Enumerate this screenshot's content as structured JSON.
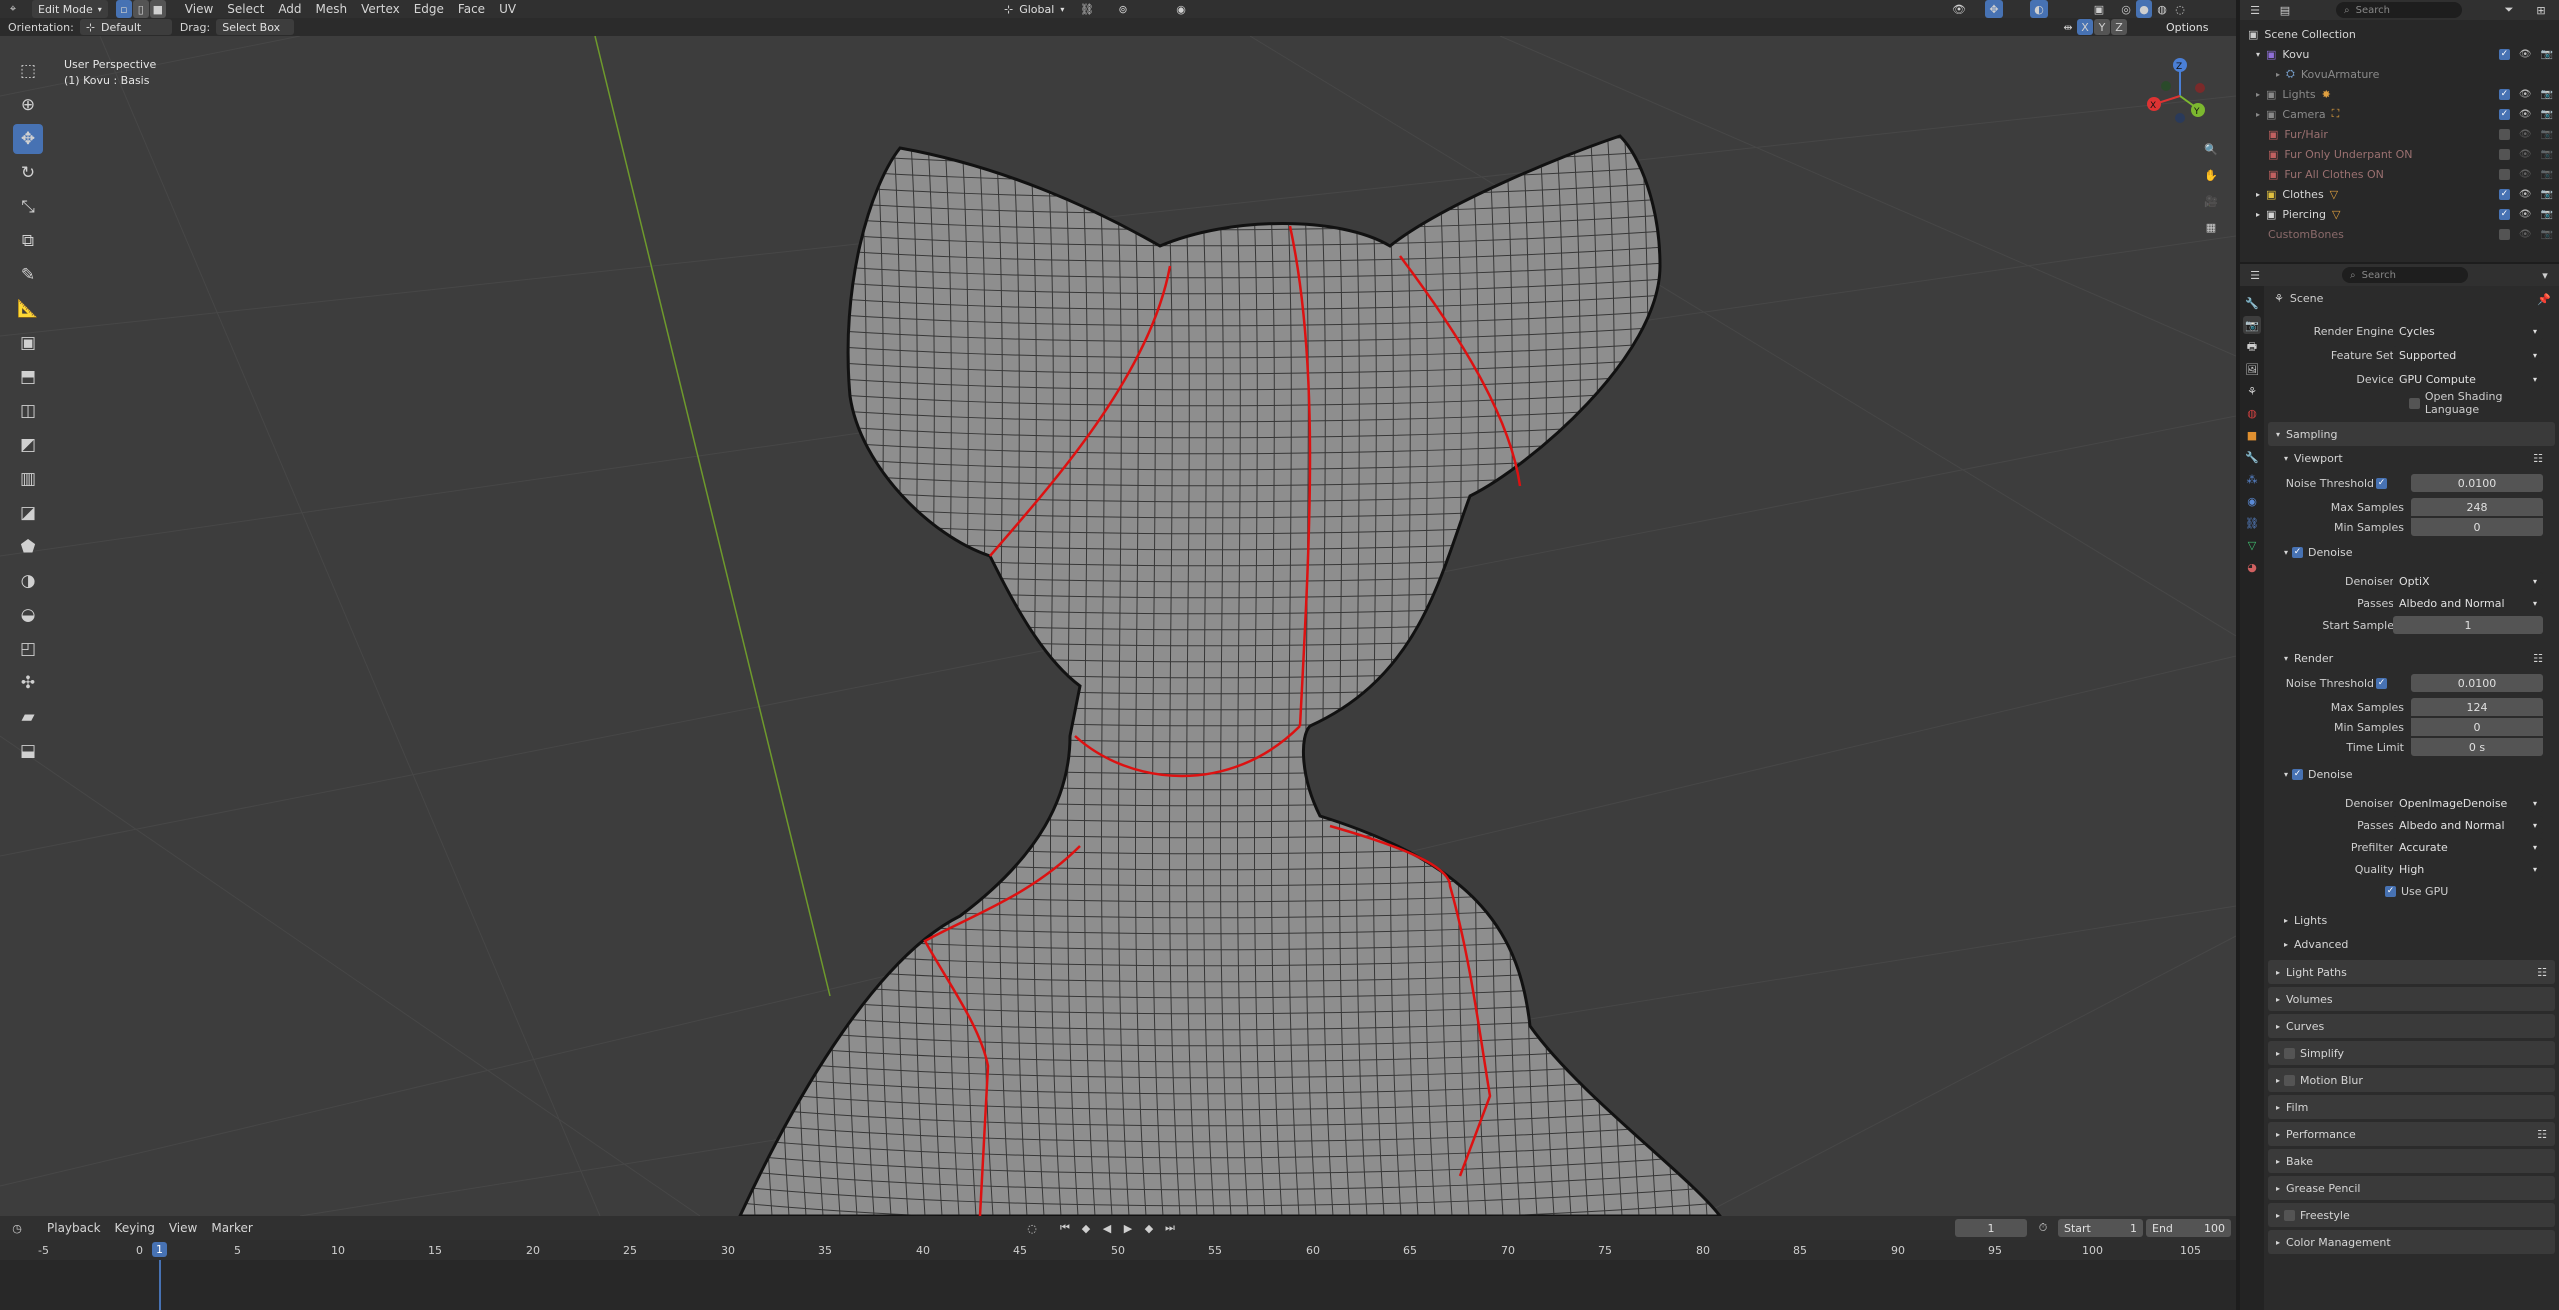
{
  "topbar": {
    "mode": "Edit Mode",
    "menus": [
      "View",
      "Select",
      "Add",
      "Mesh",
      "Vertex",
      "Edge",
      "Face",
      "UV"
    ],
    "transform_orientation": "Global",
    "search_placeholder": "Search"
  },
  "toolsettings": {
    "orientation_label": "Orientation:",
    "orientation_value": "Default",
    "drag_label": "Drag:",
    "drag_value": "Select Box",
    "axes": [
      "X",
      "Y",
      "Z"
    ],
    "options_label": "Options"
  },
  "viewport": {
    "view_name": "User Perspective",
    "object_info": "(1) Kovu : Basis",
    "gizmo_axes": [
      "X",
      "Y",
      "Z"
    ]
  },
  "outliner": {
    "title": "Scene Collection",
    "search_placeholder": "Search",
    "items": [
      {
        "label": "Kovu",
        "color": "#8f6fd8",
        "dim": false
      },
      {
        "label": "KovuArmature",
        "color": "#7aa3d0",
        "dim": true
      },
      {
        "label": "Lights",
        "color": "#7aa3d0",
        "dim": true
      },
      {
        "label": "Camera",
        "color": "#7aa3d0",
        "dim": true
      },
      {
        "label": "Fur/Hair",
        "color": "#c06060",
        "dim": true
      },
      {
        "label": "Fur Only Underpant ON",
        "color": "#c06060",
        "dim": true
      },
      {
        "label": "Fur All Clothes ON",
        "color": "#c06060",
        "dim": true
      },
      {
        "label": "Clothes",
        "color": "#e0c040",
        "dim": false
      },
      {
        "label": "Piercing",
        "color": "#e0e0e0",
        "dim": false
      },
      {
        "label": "CustomBones",
        "color": "#c06060",
        "dim": true
      }
    ]
  },
  "properties": {
    "search_placeholder": "Search",
    "context": "Scene",
    "render_engine_label": "Render Engine",
    "render_engine": "Cycles",
    "feature_set_label": "Feature Set",
    "feature_set": "Supported",
    "device_label": "Device",
    "device": "GPU Compute",
    "osl_label": "Open Shading Language",
    "sampling": "Sampling",
    "viewport": "Viewport",
    "noise_threshold_label": "Noise Threshold",
    "vp_noise_threshold": "0.0100",
    "max_samples_label": "Max Samples",
    "vp_max_samples": "248",
    "min_samples_label": "Min Samples",
    "vp_min_samples": "0",
    "denoise_label": "Denoise",
    "denoiser_label": "Denoiser",
    "vp_denoiser": "OptiX",
    "passes_label": "Passes",
    "vp_passes": "Albedo and Normal",
    "start_sample_label": "Start Sample",
    "vp_start_sample": "1",
    "render": "Render",
    "r_noise_threshold": "0.0100",
    "r_max_samples": "124",
    "r_min_samples": "0",
    "time_limit_label": "Time Limit",
    "r_time_limit": "0 s",
    "r_denoiser": "OpenImageDenoise",
    "r_passes": "Albedo and Normal",
    "prefilter_label": "Prefilter",
    "r_prefilter": "Accurate",
    "quality_label": "Quality",
    "r_quality": "High",
    "use_gpu_label": "Use GPU",
    "lights": "Lights",
    "advanced": "Advanced",
    "panels": [
      "Light Paths",
      "Volumes",
      "Curves",
      "Simplify",
      "Motion Blur",
      "Film",
      "Performance",
      "Bake",
      "Grease Pencil",
      "Freestyle",
      "Color Management"
    ]
  },
  "timeline": {
    "menus": [
      "Playback",
      "Keying",
      "View",
      "Marker"
    ],
    "current_frame": "1",
    "start_label": "Start",
    "start": "1",
    "end_label": "End",
    "end": "100",
    "ruler": [
      "-5",
      "0",
      "1",
      "5",
      "10",
      "15",
      "20",
      "25",
      "30",
      "35",
      "40",
      "45",
      "50",
      "55",
      "60",
      "65",
      "70",
      "75",
      "80",
      "85",
      "90",
      "95",
      "100",
      "105"
    ]
  }
}
